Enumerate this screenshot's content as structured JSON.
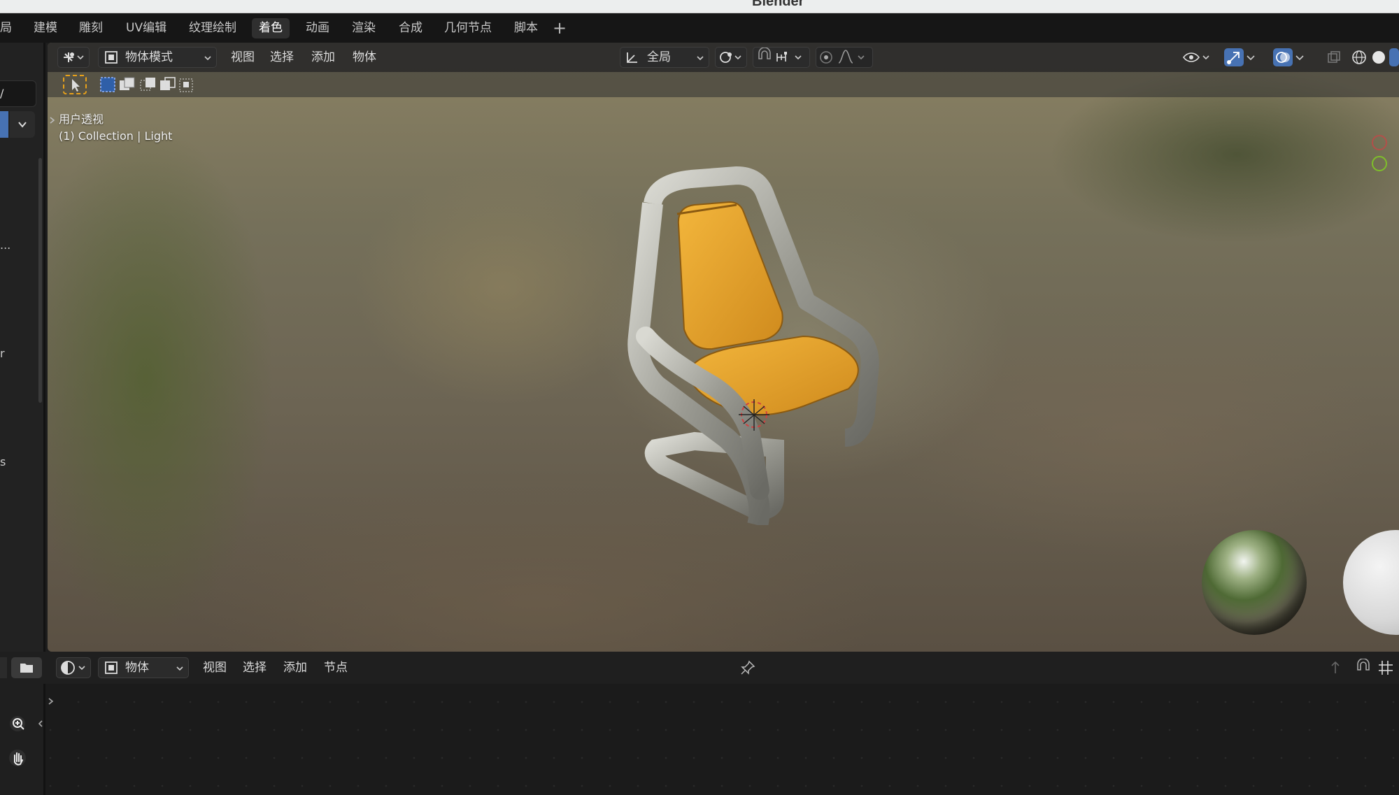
{
  "app": {
    "title": "Blender"
  },
  "workspace_tabs": [
    "局",
    "建模",
    "雕刻",
    "UV编辑",
    "纹理绘制",
    "着色",
    "动画",
    "渲染",
    "合成",
    "几何节点",
    "脚本"
  ],
  "active_tab": "着色",
  "left_panel": {
    "path_text": "/",
    "ellipsis": "...",
    "frag_r": "r",
    "frag_s": "s"
  },
  "viewport": {
    "mode": "物体模式",
    "menus": [
      "视图",
      "选择",
      "添加",
      "物体"
    ],
    "transform_orientation": "全局",
    "view_name": "用户透视",
    "collection_info": "(1) Collection | Light"
  },
  "node_editor": {
    "mode": "物体",
    "menus": [
      "视图",
      "选择",
      "添加",
      "节点"
    ]
  },
  "colors": {
    "accent_blue": "#4772b3",
    "active_orange": "#e8a11a",
    "seat_yellow": "#e6a22b",
    "gizmo_red": "#c34747",
    "gizmo_green": "#7fbf2a"
  }
}
